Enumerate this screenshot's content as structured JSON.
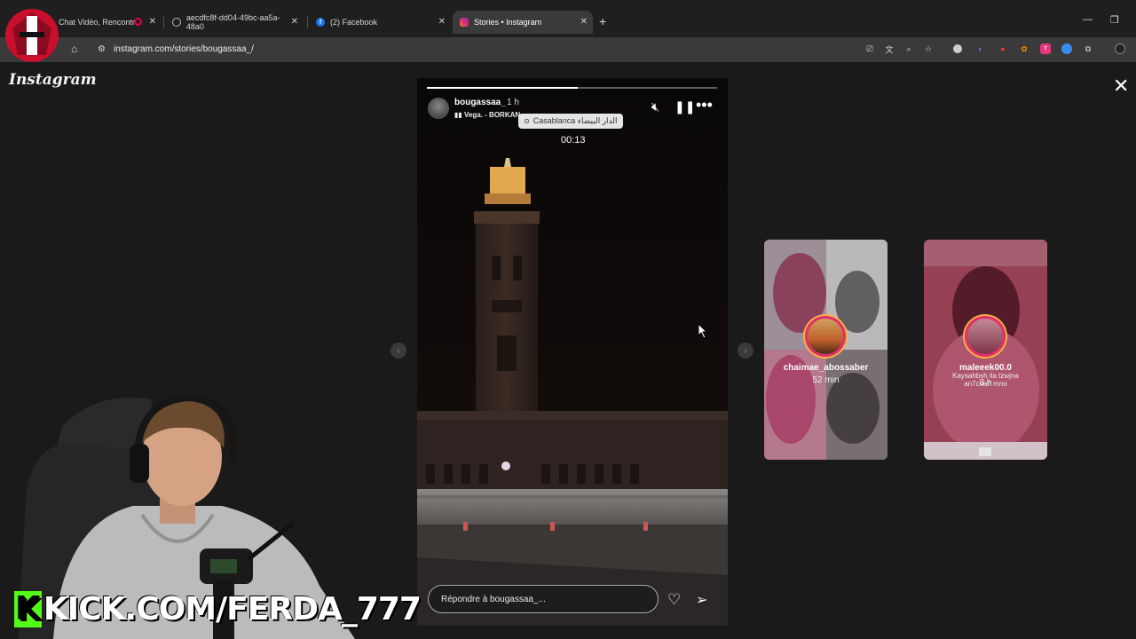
{
  "browser": {
    "tabs": [
      {
        "title": "Chat Vidéo, Rencontr",
        "favicon": "video-icon"
      },
      {
        "title": "aecdfc8f-dd04-49bc-aa5a-48a0",
        "favicon": "globe-icon"
      },
      {
        "title": "(2) Facebook",
        "favicon": "facebook-icon"
      },
      {
        "title": "Stories • Instagram",
        "favicon": "instagram-icon"
      }
    ],
    "url": "instagram.com/stories/bougassaa_/"
  },
  "page": {
    "logo": "Instagram"
  },
  "story": {
    "username": "bougassaa_",
    "time": "1 h",
    "music": "Vega. - BORKAN",
    "location": "Casablanca الدار البيضاء",
    "timer": "00:13",
    "progress": 0.52,
    "reply_placeholder": "Répondre à bougassaa_..."
  },
  "side_stories": [
    {
      "username": "chaimae_abossaber",
      "time": "52 min"
    },
    {
      "username": "maleeek00.0",
      "time": "3 h",
      "caption": "Kaysahbsh lia tzwjna an7chah mno"
    }
  ],
  "overlay": {
    "channel": "KICK.COM/FERDA_777"
  },
  "colors": {
    "kick_green": "#53fc18",
    "story_ring": "#e1306c",
    "ring_gold": "#f5b342"
  }
}
